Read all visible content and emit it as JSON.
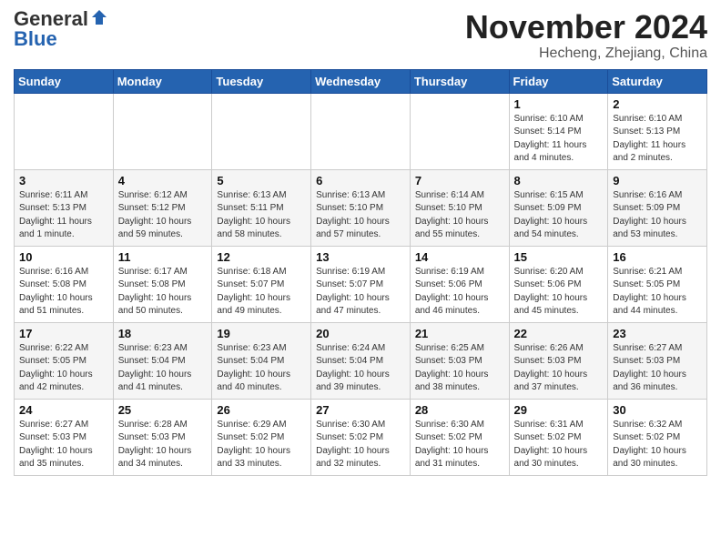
{
  "header": {
    "logo_general": "General",
    "logo_blue": "Blue",
    "month_title": "November 2024",
    "location": "Hecheng, Zhejiang, China"
  },
  "days_of_week": [
    "Sunday",
    "Monday",
    "Tuesday",
    "Wednesday",
    "Thursday",
    "Friday",
    "Saturday"
  ],
  "weeks": [
    [
      {
        "day": "",
        "info": ""
      },
      {
        "day": "",
        "info": ""
      },
      {
        "day": "",
        "info": ""
      },
      {
        "day": "",
        "info": ""
      },
      {
        "day": "",
        "info": ""
      },
      {
        "day": "1",
        "info": "Sunrise: 6:10 AM\nSunset: 5:14 PM\nDaylight: 11 hours\nand 4 minutes."
      },
      {
        "day": "2",
        "info": "Sunrise: 6:10 AM\nSunset: 5:13 PM\nDaylight: 11 hours\nand 2 minutes."
      }
    ],
    [
      {
        "day": "3",
        "info": "Sunrise: 6:11 AM\nSunset: 5:13 PM\nDaylight: 11 hours\nand 1 minute."
      },
      {
        "day": "4",
        "info": "Sunrise: 6:12 AM\nSunset: 5:12 PM\nDaylight: 10 hours\nand 59 minutes."
      },
      {
        "day": "5",
        "info": "Sunrise: 6:13 AM\nSunset: 5:11 PM\nDaylight: 10 hours\nand 58 minutes."
      },
      {
        "day": "6",
        "info": "Sunrise: 6:13 AM\nSunset: 5:10 PM\nDaylight: 10 hours\nand 57 minutes."
      },
      {
        "day": "7",
        "info": "Sunrise: 6:14 AM\nSunset: 5:10 PM\nDaylight: 10 hours\nand 55 minutes."
      },
      {
        "day": "8",
        "info": "Sunrise: 6:15 AM\nSunset: 5:09 PM\nDaylight: 10 hours\nand 54 minutes."
      },
      {
        "day": "9",
        "info": "Sunrise: 6:16 AM\nSunset: 5:09 PM\nDaylight: 10 hours\nand 53 minutes."
      }
    ],
    [
      {
        "day": "10",
        "info": "Sunrise: 6:16 AM\nSunset: 5:08 PM\nDaylight: 10 hours\nand 51 minutes."
      },
      {
        "day": "11",
        "info": "Sunrise: 6:17 AM\nSunset: 5:08 PM\nDaylight: 10 hours\nand 50 minutes."
      },
      {
        "day": "12",
        "info": "Sunrise: 6:18 AM\nSunset: 5:07 PM\nDaylight: 10 hours\nand 49 minutes."
      },
      {
        "day": "13",
        "info": "Sunrise: 6:19 AM\nSunset: 5:07 PM\nDaylight: 10 hours\nand 47 minutes."
      },
      {
        "day": "14",
        "info": "Sunrise: 6:19 AM\nSunset: 5:06 PM\nDaylight: 10 hours\nand 46 minutes."
      },
      {
        "day": "15",
        "info": "Sunrise: 6:20 AM\nSunset: 5:06 PM\nDaylight: 10 hours\nand 45 minutes."
      },
      {
        "day": "16",
        "info": "Sunrise: 6:21 AM\nSunset: 5:05 PM\nDaylight: 10 hours\nand 44 minutes."
      }
    ],
    [
      {
        "day": "17",
        "info": "Sunrise: 6:22 AM\nSunset: 5:05 PM\nDaylight: 10 hours\nand 42 minutes."
      },
      {
        "day": "18",
        "info": "Sunrise: 6:23 AM\nSunset: 5:04 PM\nDaylight: 10 hours\nand 41 minutes."
      },
      {
        "day": "19",
        "info": "Sunrise: 6:23 AM\nSunset: 5:04 PM\nDaylight: 10 hours\nand 40 minutes."
      },
      {
        "day": "20",
        "info": "Sunrise: 6:24 AM\nSunset: 5:04 PM\nDaylight: 10 hours\nand 39 minutes."
      },
      {
        "day": "21",
        "info": "Sunrise: 6:25 AM\nSunset: 5:03 PM\nDaylight: 10 hours\nand 38 minutes."
      },
      {
        "day": "22",
        "info": "Sunrise: 6:26 AM\nSunset: 5:03 PM\nDaylight: 10 hours\nand 37 minutes."
      },
      {
        "day": "23",
        "info": "Sunrise: 6:27 AM\nSunset: 5:03 PM\nDaylight: 10 hours\nand 36 minutes."
      }
    ],
    [
      {
        "day": "24",
        "info": "Sunrise: 6:27 AM\nSunset: 5:03 PM\nDaylight: 10 hours\nand 35 minutes."
      },
      {
        "day": "25",
        "info": "Sunrise: 6:28 AM\nSunset: 5:03 PM\nDaylight: 10 hours\nand 34 minutes."
      },
      {
        "day": "26",
        "info": "Sunrise: 6:29 AM\nSunset: 5:02 PM\nDaylight: 10 hours\nand 33 minutes."
      },
      {
        "day": "27",
        "info": "Sunrise: 6:30 AM\nSunset: 5:02 PM\nDaylight: 10 hours\nand 32 minutes."
      },
      {
        "day": "28",
        "info": "Sunrise: 6:30 AM\nSunset: 5:02 PM\nDaylight: 10 hours\nand 31 minutes."
      },
      {
        "day": "29",
        "info": "Sunrise: 6:31 AM\nSunset: 5:02 PM\nDaylight: 10 hours\nand 30 minutes."
      },
      {
        "day": "30",
        "info": "Sunrise: 6:32 AM\nSunset: 5:02 PM\nDaylight: 10 hours\nand 30 minutes."
      }
    ]
  ]
}
